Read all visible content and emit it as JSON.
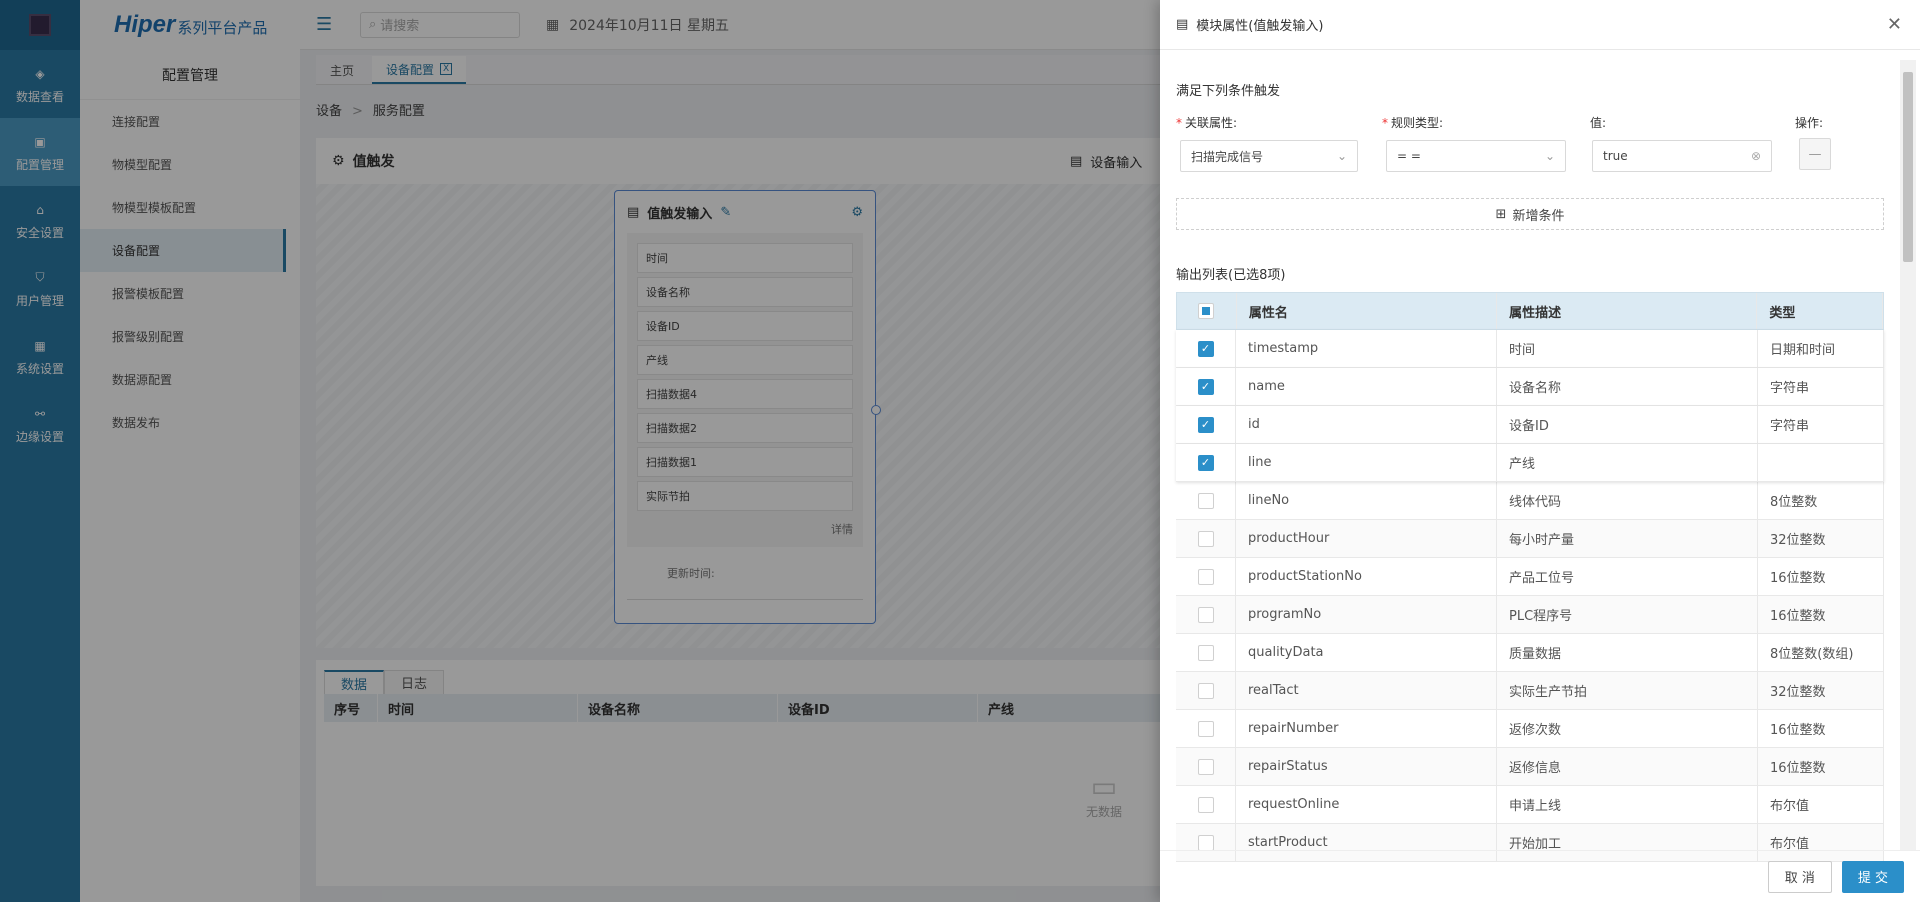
{
  "brand": {
    "name": "Hiper",
    "suffix": "系列平台产品"
  },
  "rail": [
    {
      "label": "数据查看",
      "icon": "cube-icon",
      "active": false
    },
    {
      "label": "配置管理",
      "icon": "clipboard-icon",
      "active": true
    },
    {
      "label": "安全设置",
      "icon": "house-lock-icon",
      "active": false
    },
    {
      "label": "用户管理",
      "icon": "shield-user-icon",
      "active": false
    },
    {
      "label": "系统设置",
      "icon": "settings-panel-icon",
      "active": false
    },
    {
      "label": "边缘设置",
      "icon": "network-icon",
      "active": false
    }
  ],
  "header": {
    "search_placeholder": "请搜索",
    "date": "2024年10月11日 星期五"
  },
  "subnav": {
    "title": "配置管理",
    "items": [
      "连接配置",
      "物模型配置",
      "物模型模板配置",
      "设备配置",
      "报警模板配置",
      "报警级别配置",
      "数据源配置",
      "数据发布"
    ],
    "active_index": 3
  },
  "tabs": [
    {
      "label": "主页"
    },
    {
      "label": "设备配置",
      "close": "X"
    }
  ],
  "breadcrumb": [
    "设备",
    "服务配置"
  ],
  "canvas": {
    "title": "值触发",
    "device_button": "设备输入"
  },
  "node": {
    "title": "值触发输入",
    "fields": [
      "时间",
      "设备名称",
      "设备ID",
      "产线",
      "扫描数据4",
      "扫描数据2",
      "扫描数据1",
      "实际节拍"
    ],
    "detail": "详情",
    "update_time": "更新时间:"
  },
  "bottom": {
    "tabs": [
      "数据",
      "日志"
    ],
    "columns": [
      "序号",
      "时间",
      "设备名称",
      "设备ID",
      "产线"
    ],
    "empty": "无数据"
  },
  "drawer": {
    "title": "模块属性(值触发输入)",
    "cond_title": "满足下列条件触发",
    "labels": {
      "attr": "关联属性:",
      "rule": "规则类型:",
      "value": "值:",
      "op": "操作:"
    },
    "values": {
      "attr": "扫描完成信号",
      "rule": "= =",
      "value": "true"
    },
    "add_condition": "新增条件",
    "output_title": "输出列表(已选8项)",
    "columns": [
      "属性名",
      "属性描述",
      "类型"
    ],
    "rows": [
      {
        "name": "timestamp",
        "desc": "时间",
        "type": "日期和时间",
        "checked": true
      },
      {
        "name": "name",
        "desc": "设备名称",
        "type": "字符串",
        "checked": true
      },
      {
        "name": "id",
        "desc": "设备ID",
        "type": "字符串",
        "checked": true
      },
      {
        "name": "line",
        "desc": "产线",
        "type": "",
        "checked": true
      },
      {
        "name": "lineNo",
        "desc": "线体代码",
        "type": "8位整数",
        "checked": false
      },
      {
        "name": "productHour",
        "desc": "每小时产量",
        "type": "32位整数",
        "checked": false
      },
      {
        "name": "productStationNo",
        "desc": "产品工位号",
        "type": "16位整数",
        "checked": false
      },
      {
        "name": "programNo",
        "desc": "PLC程序号",
        "type": "16位整数",
        "checked": false
      },
      {
        "name": "qualityData",
        "desc": "质量数据",
        "type": "8位整数(数组)",
        "checked": false
      },
      {
        "name": "realTact",
        "desc": "实际生产节拍",
        "type": "32位整数",
        "checked": false
      },
      {
        "name": "repairNumber",
        "desc": "返修次数",
        "type": "16位整数",
        "checked": false
      },
      {
        "name": "repairStatus",
        "desc": "返修信息",
        "type": "16位整数",
        "checked": false
      },
      {
        "name": "requestOnline",
        "desc": "申请上线",
        "type": "布尔值",
        "checked": false
      },
      {
        "name": "startProduct",
        "desc": "开始加工",
        "type": "布尔值",
        "checked": false
      }
    ],
    "cancel": "取 消",
    "submit": "提 交"
  },
  "colors": {
    "rail": "#2b7aa6",
    "accent": "#2b8fc9",
    "required": "#e33333"
  }
}
